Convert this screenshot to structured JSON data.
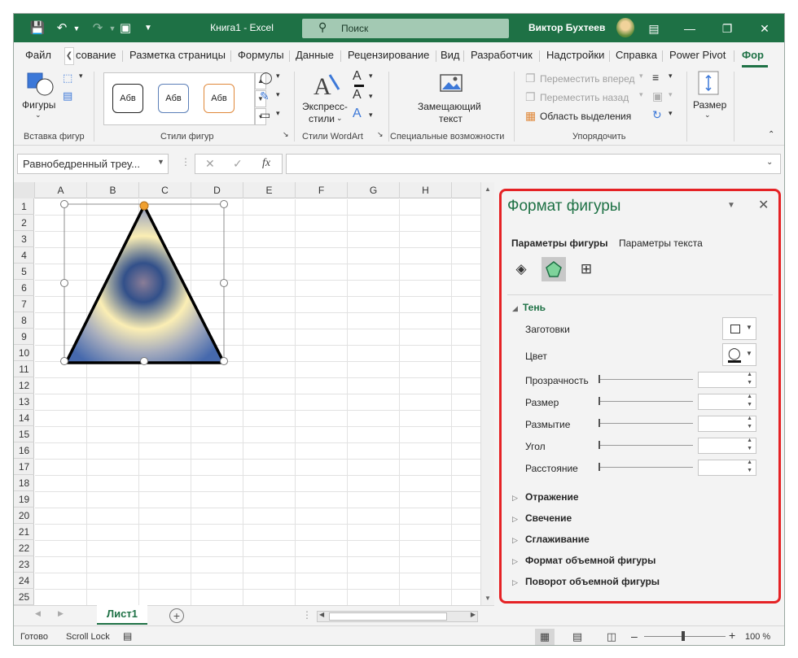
{
  "titlebar": {
    "title": "Книга1  -  Excel",
    "search_label": "Поиск",
    "user_name": "Виктор Бухтеев"
  },
  "tabs": [
    "Файл",
    "сование",
    "Разметка страницы",
    "Формулы",
    "Данные",
    "Рецензирование",
    "Вид",
    "Разработчик",
    "Надстройки",
    "Справка",
    "Power Pivot"
  ],
  "active_tab": "Фор",
  "ribbon": {
    "insert_shapes": {
      "shapes_label": "Фигуры",
      "group_label": "Вставка фигур"
    },
    "shape_styles": {
      "style_sample": "Абв",
      "group_label": "Стили фигур"
    },
    "wordart": {
      "express_label": "Экспресс-",
      "styles_label": "стили",
      "group_label": "Стили WordArt"
    },
    "accessibility": {
      "alt_text_line1": "Замещающий",
      "alt_text_line2": "текст",
      "group_label": "Специальные возможности"
    },
    "arrange": {
      "bring_forward": "Переместить вперед",
      "send_backward": "Переместить назад",
      "selection_pane": "Область выделения",
      "group_label": "Упорядочить"
    },
    "size": {
      "label": "Размер"
    }
  },
  "formula_bar": {
    "name_box": "Равнобедренный треу...",
    "fx": "fx",
    "formula": ""
  },
  "grid": {
    "columns": [
      "A",
      "B",
      "C",
      "D",
      "E",
      "F",
      "G",
      "H"
    ],
    "rows": [
      "1",
      "2",
      "3",
      "4",
      "5",
      "6",
      "7",
      "8",
      "9",
      "10",
      "11",
      "12",
      "13",
      "14",
      "15",
      "16",
      "17",
      "18",
      "19",
      "20",
      "21",
      "22",
      "23",
      "24",
      "25"
    ]
  },
  "sheet": {
    "active_sheet": "Лист1"
  },
  "pane": {
    "title": "Формат фигуры",
    "tab_shape": "Параметры фигуры",
    "tab_text": "Параметры текста",
    "shadow_section": "Тень",
    "presets_label": "Заготовки",
    "color_label": "Цвет",
    "transparency_label": "Прозрачность",
    "size_label": "Размер",
    "blur_label": "Размытие",
    "angle_label": "Угол",
    "distance_label": "Расстояние",
    "sections": [
      "Отражение",
      "Свечение",
      "Сглаживание",
      "Формат объемной фигуры",
      "Поворот объемной фигуры"
    ]
  },
  "status": {
    "ready": "Готово",
    "scroll_lock": "Scroll Lock",
    "zoom": "100 %"
  },
  "colors": {
    "excel_green": "#1e7145",
    "highlight_red": "#e52225"
  }
}
